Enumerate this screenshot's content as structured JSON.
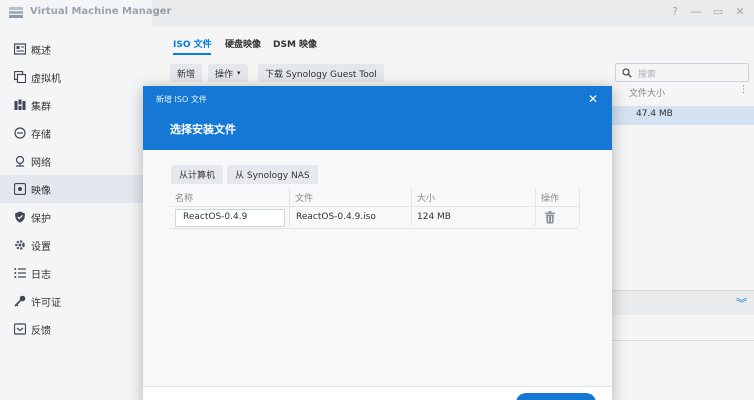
{
  "window": {
    "title": "Virtual Machine Manager",
    "controls": [
      "?",
      "—",
      "▭",
      "✕"
    ]
  },
  "sidebar": {
    "items": [
      {
        "label": "概述",
        "icon": "overview-icon"
      },
      {
        "label": "虚拟机",
        "icon": "vm-icon"
      },
      {
        "label": "集群",
        "icon": "cluster-icon"
      },
      {
        "label": "存储",
        "icon": "storage-icon"
      },
      {
        "label": "网络",
        "icon": "network-icon"
      },
      {
        "label": "映像",
        "icon": "image-icon",
        "active": true
      },
      {
        "label": "保护",
        "icon": "shield-icon"
      },
      {
        "label": "设置",
        "icon": "gear-icon"
      },
      {
        "label": "日志",
        "icon": "log-icon"
      },
      {
        "label": "许可证",
        "icon": "key-icon"
      },
      {
        "label": "反馈",
        "icon": "feedback-icon"
      }
    ]
  },
  "main": {
    "tabs": [
      {
        "label": "ISO 文件",
        "active": true
      },
      {
        "label": "硬盘映像"
      },
      {
        "label": "DSM 映像"
      }
    ],
    "toolbar": {
      "add_label": "新增",
      "action_label": "操作",
      "download_label": "下载 Synology Guest Tool"
    },
    "search": {
      "placeholder": "搜索"
    },
    "table": {
      "column_header": "文件大小",
      "selected_row_value": "47.4 MB"
    }
  },
  "dialog": {
    "title": "新增 ISO 文件",
    "subtitle": "选择安装文件",
    "source_buttons": [
      "从计算机",
      "从 Synology NAS"
    ],
    "columns": [
      "名称",
      "文件",
      "大小",
      "操作"
    ],
    "row": {
      "name": "ReactOS-0.4.9",
      "file": "ReactOS-0.4.9.iso",
      "size": "124 MB"
    }
  },
  "colors": {
    "accent": "#0086e5",
    "dialog_header": "#1478d4",
    "sidebar_bg": "#f3f5f7",
    "selected_row": "#dcebfa"
  }
}
